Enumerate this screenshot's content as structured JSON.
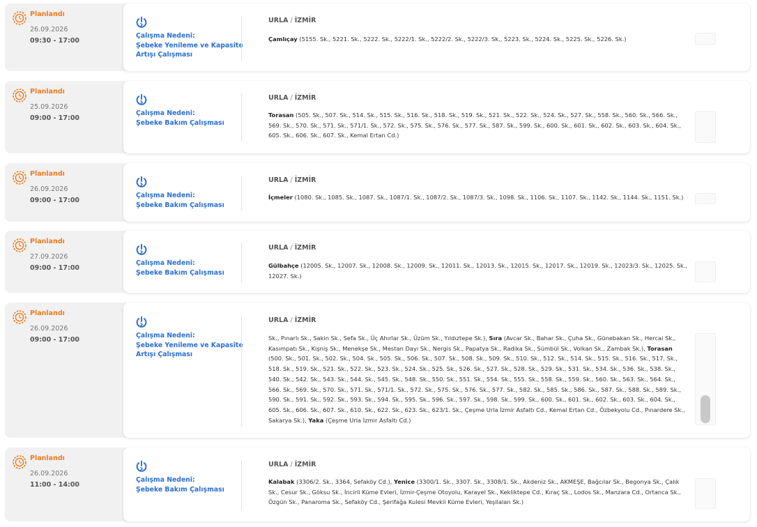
{
  "status_label": "Planlandı",
  "reason_label": "Çalışma Nedeni:",
  "icons": {
    "status": "gear-clock-icon",
    "reason": "power-off-icon"
  },
  "colors": {
    "status": "#f07a1f",
    "reason": "#2a6fd6"
  },
  "outages": [
    {
      "date": "26.09.2026",
      "time": "09:30 - 17:00",
      "reason": "Şebeke Yenileme ve Kapasite Artışı Çalışması",
      "district": "URLA",
      "city": "İZMİR",
      "areas": [
        {
          "name": "Çamlıçay",
          "streets": "(5155. Sk., 5221. Sk., 5222. Sk., 5222/1. Sk., 5222/2. Sk., 5222/3. Sk., 5223. Sk., 5224. Sk., 5225. Sk., 5226. Sk.)"
        }
      ]
    },
    {
      "date": "25.09.2026",
      "time": "09:00 - 17:00",
      "reason": "Şebeke Bakım Çalışması",
      "district": "URLA",
      "city": "İZMİR",
      "areas": [
        {
          "name": "Torasan",
          "streets": "(505. Sk., 507. Sk., 514. Sk., 515. Sk., 516. Sk., 518. Sk., 519. Sk., 521. Sk., 522. Sk., 524. Sk., 527. Sk., 558. Sk., 560. Sk., 566. Sk., 569. Sk., 570. Sk., 571. Sk., 571/1. Sk., 572. Sk., 575. Sk., 576. Sk., 577. Sk., 587. Sk., 599. Sk., 600. Sk., 601. Sk., 602. Sk., 603. Sk., 604. Sk., 605. Sk., 606. Sk., 607. Sk., Kemal Ertan Cd.)"
        }
      ]
    },
    {
      "date": "26.09.2026",
      "time": "09:00 - 17:00",
      "reason": "Şebeke Bakım Çalışması",
      "district": "URLA",
      "city": "İZMİR",
      "areas": [
        {
          "name": "İçmeler",
          "streets": "(1080. Sk., 1085. Sk., 1087. Sk., 1087/1. Sk., 1087/2. Sk., 1087/3. Sk., 1098. Sk., 1106. Sk., 1107. Sk., 1142. Sk., 1144. Sk., 1151. Sk.)"
        }
      ]
    },
    {
      "date": "27.09.2026",
      "time": "09:00 - 17:00",
      "reason": "Şebeke Bakım Çalışması",
      "district": "URLA",
      "city": "İZMİR",
      "areas": [
        {
          "name": "Gülbahçe",
          "streets": "(12005. Sk., 12007. Sk., 12008. Sk., 12009. Sk., 12011. Sk., 12013. Sk., 12015. Sk., 12017. Sk., 12019. Sk., 12023/3. Sk., 12025. Sk., 12027. Sk.)"
        }
      ]
    },
    {
      "date": "26.09.2026",
      "time": "09:00 - 17:00",
      "reason": "Şebeke Yenileme ve Kapasite Artışı Çalışması",
      "district": "URLA",
      "city": "İZMİR",
      "areas": [
        {
          "name": "",
          "streets": "Sk., Pınarlı Sk., Sakin Sk., Sefa Sk., Üç Ahırlar Sk., Üzüm Sk., Yıldıztepe Sk.),"
        },
        {
          "name": "Sıra",
          "streets": "(Avcar Sk., Bahar Sk., Çuha Sk., Günebakan Sk., Hercai Sk., Kasımpatı Sk., Kişniş Sk., Menekşe Sk., Mestan Dayı Sk., Nergis Sk., Papatya Sk., Radika Sk., Sümbül Sk., Volkan Sk., Zambak Sk.),"
        },
        {
          "name": "Torasan",
          "streets": "(500. Sk., 501. Sk., 502. Sk., 504. Sk., 505. Sk., 506. Sk., 507. Sk., 508. Sk., 509. Sk., 510. Sk., 512. Sk., 514. Sk., 515. Sk., 516. Sk., 517. Sk., 518. Sk., 519. Sk., 521. Sk., 522. Sk., 523. Sk., 524. Sk., 525. Sk., 526. Sk., 527. Sk., 528. Sk., 529. Sk., 531. Sk., 534. Sk., 536. Sk., 538. Sk., 540. Sk., 542. Sk., 543. Sk., 544. Sk., 545. Sk., 548. Sk., 550. Sk., 551. Sk., 554. Sk., 555. Sk., 558. Sk., 559. Sk., 560. Sk., 563. Sk., 564. Sk., 566. Sk., 569. Sk., 570. Sk., 571. Sk., 571/1. Sk., 572. Sk., 575. Sk., 576. Sk., 577. Sk., 582. Sk., 585. Sk., 586. Sk., 587. Sk., 588. Sk., 589. Sk., 590. Sk., 591. Sk., 592. Sk., 593. Sk., 594. Sk., 595. Sk., 596. Sk., 597. Sk., 598. Sk., 599. Sk., 600. Sk., 601. Sk., 602. Sk., 603. Sk., 604. Sk., 605. Sk., 606. Sk., 607. Sk., 610. Sk., 622. Sk., 623. Sk., 623/1. Sk., Çeşme Urla İzmir Asfaltı Cd., Kemal Ertan Cd., Özbekyolu Cd., Pınardere Sk., Sakarya Sk.),"
        },
        {
          "name": "Yaka",
          "streets": "(Çeşme Urla İzmir Asfaltı Cd.)"
        }
      ]
    },
    {
      "date": "26.09.2026",
      "time": "11:00 - 14:00",
      "reason": "Şebeke Bakım Çalışması",
      "district": "URLA",
      "city": "İZMİR",
      "areas": [
        {
          "name": "Kalabak",
          "streets": "(3306/2. Sk., 3364, Sefaköy Cd.),"
        },
        {
          "name": "Yenice",
          "streets": "(3300/1. Sk., 3307. Sk., 3308/1. Sk., Akdeniz Sk., AKMEŞE, Bağcılar Sk., Begonya Sk., Çalık Sk., Cesur Sk., Göksu Sk., İncirli Küme Evleri, İzmir-Çeşme Otoyolu, Karayel Sk., Kekliktepe Cd., Kıraç Sk., Lodos Sk., Manzara Cd., Ortanca Sk., Özgün Sk., Panaroma Sk., Sefaköy Cd., Şerifağa Kulesi Mevkii Küme Evleri, Yeşilalan Sk.)"
        }
      ]
    }
  ]
}
